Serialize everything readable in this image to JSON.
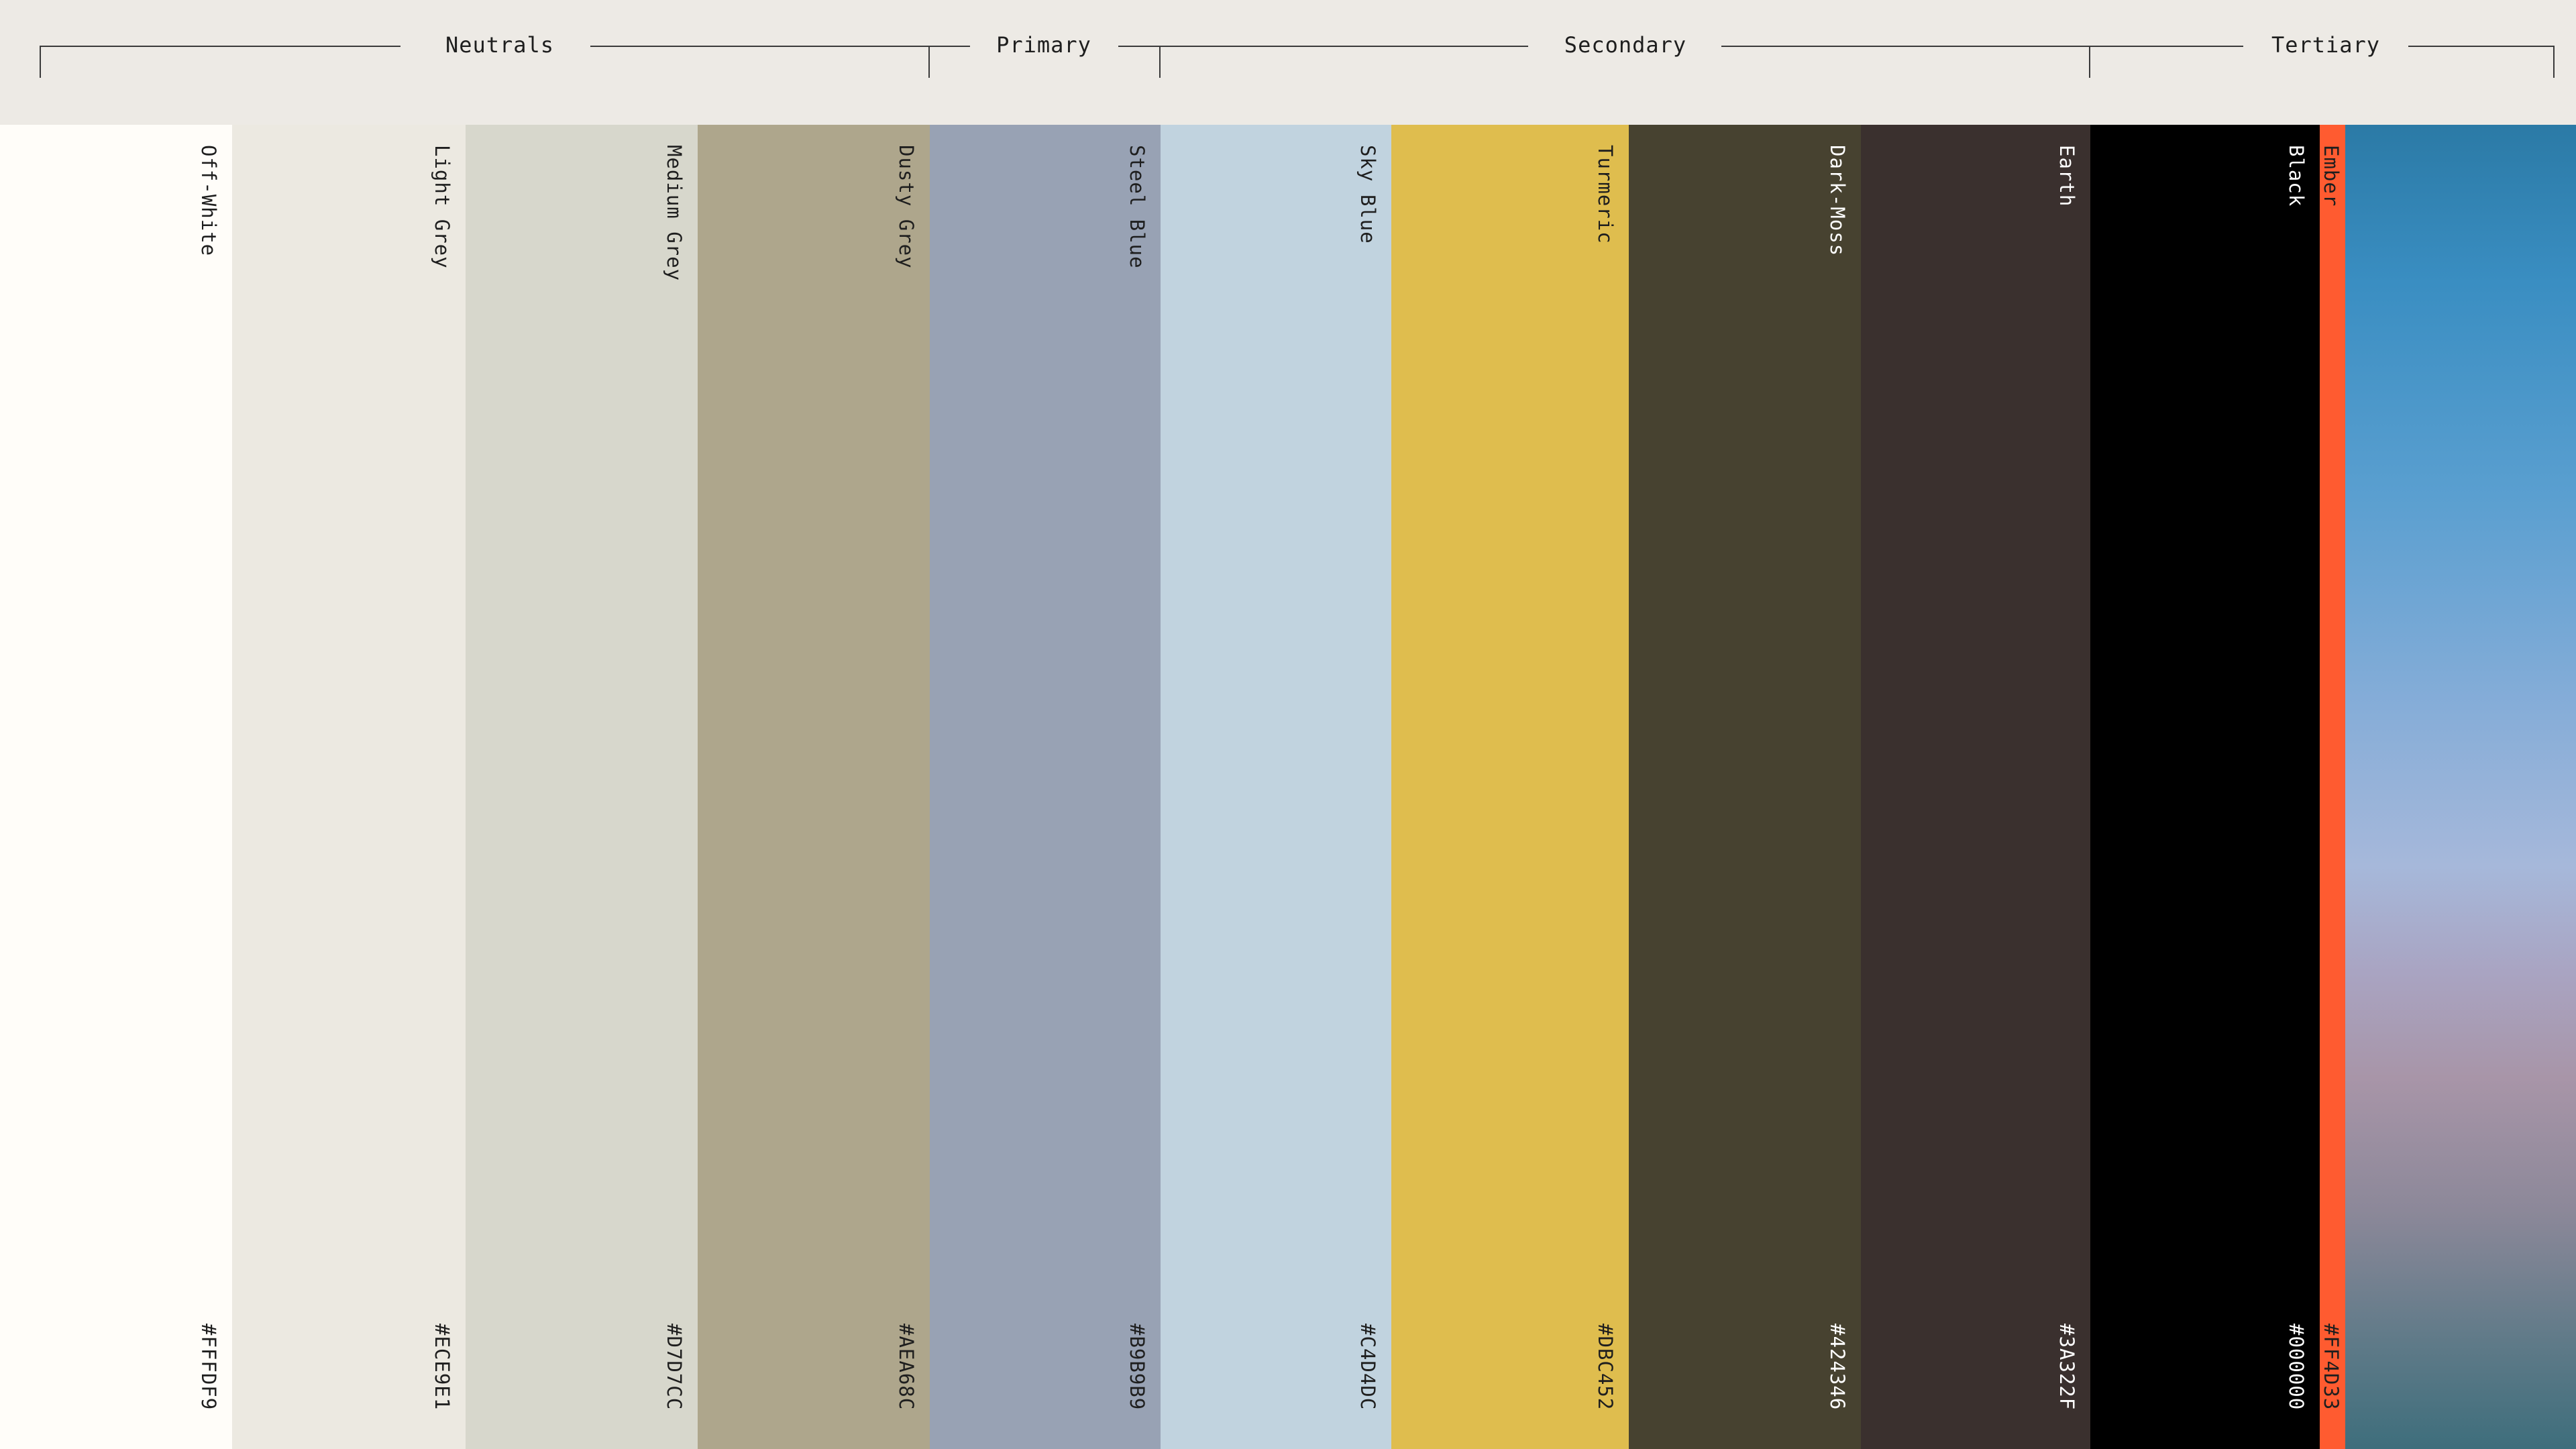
{
  "groups": {
    "neutrals": "Neutrals",
    "primary": "Primary",
    "secondary": "Secondary",
    "tertiary": "Tertiary"
  },
  "swatches": [
    {
      "name": "Off-White",
      "hex": "#FFFDF9",
      "text_color": "#1E1E1E"
    },
    {
      "name": "Light Grey",
      "hex": "#ECE9E1",
      "text_color": "#1E1E1E"
    },
    {
      "name": "Medium Grey",
      "hex": "#D7D7CC",
      "text_color": "#1E1E1E"
    },
    {
      "name": "Dusty Grey",
      "hex": "#AEA68C",
      "text_color": "#1E1E1E"
    },
    {
      "name": "Steel Blue",
      "hex": "#B9B9B9",
      "display_color": "#98A2B4",
      "text_color": "#1E1E1E"
    },
    {
      "name": "Sky Blue",
      "hex": "#C4D4DC",
      "display_color": "#C1D3DF",
      "text_color": "#1E1E1E"
    },
    {
      "name": "Turmeric",
      "hex": "#DBC452",
      "display_color": "#DFBD4E",
      "text_color": "#1E1E1E"
    },
    {
      "name": "Dark-Moss",
      "hex": "#424346",
      "display_color": "#474230",
      "text_color": "#FFFFFF"
    },
    {
      "name": "Earth",
      "hex": "#3A322F",
      "display_color": "#3A302E",
      "text_color": "#FFFFFF"
    },
    {
      "name": "Black",
      "hex": "#000000",
      "text_color": "#FFFFFF"
    },
    {
      "name": "Ember",
      "hex": "#FF4D33",
      "display_color": "#FF5B30",
      "text_color": "#1E1E1E"
    }
  ]
}
